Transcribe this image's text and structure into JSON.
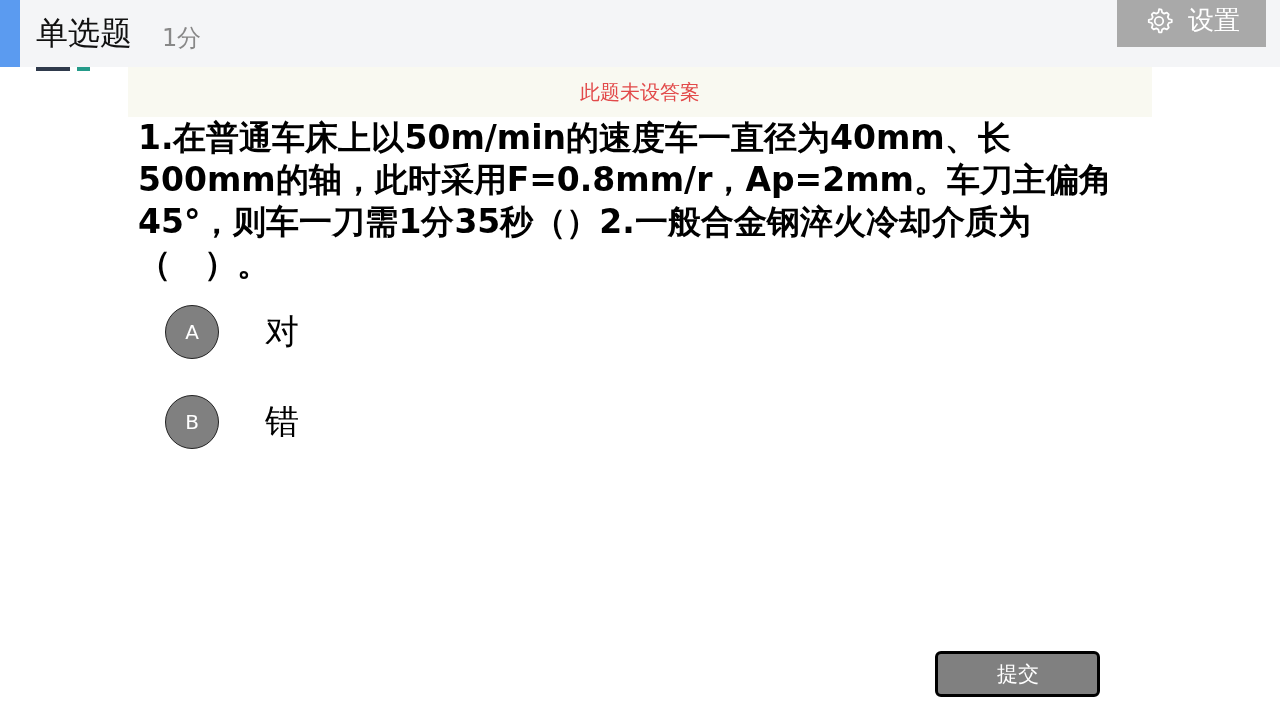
{
  "header": {
    "title": "单选题",
    "score": "1分",
    "settings_button": "设置"
  },
  "notice": "此题未设答案",
  "question": "1.在普通车床上以50m/min的速度车一直径为40mm、长500mm的轴，此时采用F=0.8mm/r，Ap=2mm。车刀主偏角45°，则车一刀需1分35秒（）2.一般合金钢淬火冷却介质为（　）。",
  "options": [
    {
      "letter": "A",
      "text": "对"
    },
    {
      "letter": "B",
      "text": "错"
    }
  ],
  "submit_button": "提交"
}
